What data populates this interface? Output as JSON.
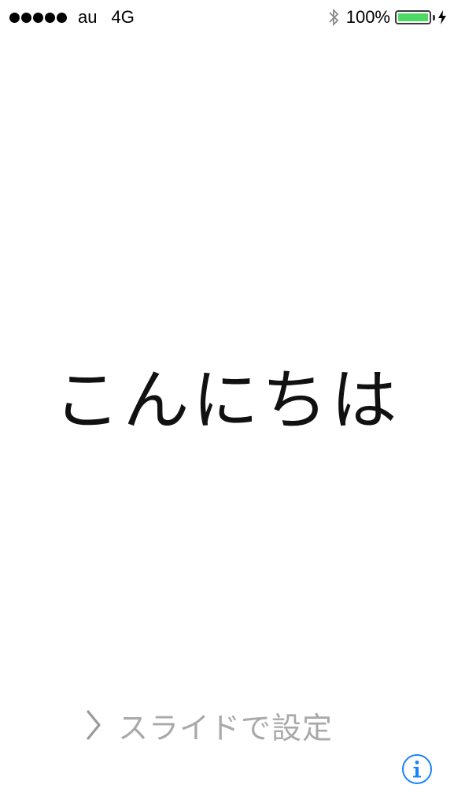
{
  "status_bar": {
    "carrier": "au",
    "network": "4G",
    "battery_percent": "100%",
    "battery_level": 1.0,
    "signal_bars": 5,
    "bluetooth_icon": "bluetooth-icon",
    "charging_icon": "bolt-icon"
  },
  "main": {
    "greeting": "こんにちは"
  },
  "slide": {
    "label": "スライドで設定",
    "icon": "chevron-right-icon"
  },
  "info": {
    "icon": "info-icon"
  },
  "colors": {
    "battery_fill": "#4cd964",
    "slide_text": "#a9a9a9",
    "info_accent": "#1a82fb",
    "greeting_text": "#111111"
  }
}
